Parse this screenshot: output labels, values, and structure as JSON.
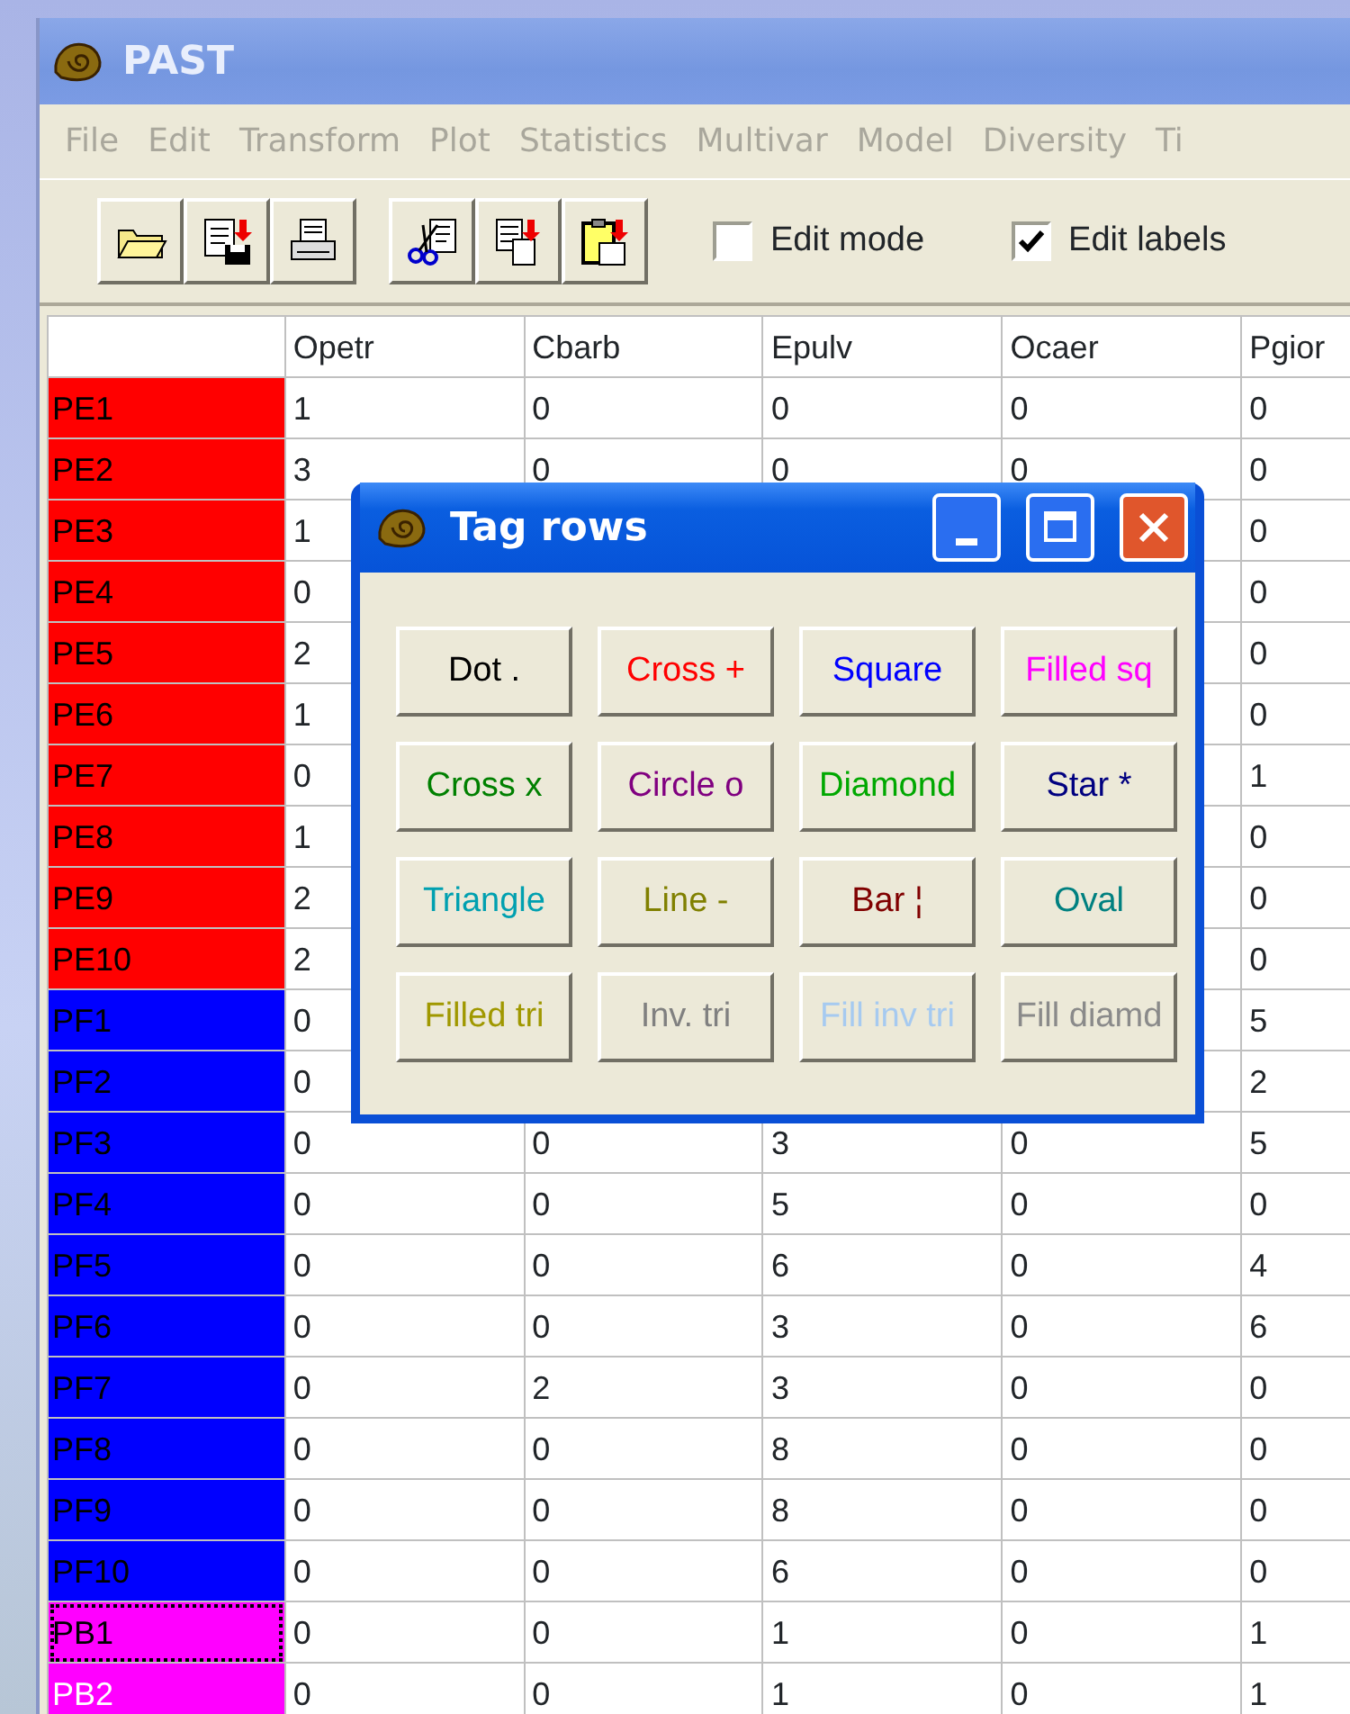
{
  "window": {
    "title": "PAST"
  },
  "menu": [
    "File",
    "Edit",
    "Transform",
    "Plot",
    "Statistics",
    "Multivar",
    "Model",
    "Diversity",
    "Ti"
  ],
  "toolbar": {
    "groups": [
      [
        {
          "kind": "open"
        },
        {
          "kind": "save"
        },
        {
          "kind": "print"
        }
      ],
      [
        {
          "kind": "cut"
        },
        {
          "kind": "copy"
        },
        {
          "kind": "paste"
        }
      ]
    ],
    "checkboxes": [
      {
        "label": "Edit mode",
        "checked": false
      },
      {
        "label": "Edit labels",
        "checked": true
      }
    ]
  },
  "table": {
    "columns": [
      "Opetr",
      "Cbarb",
      "Epulv",
      "Ocaer",
      "Pgior"
    ],
    "rows": [
      {
        "label": "PE1",
        "color": "#ff0000",
        "focused": false,
        "selected": false,
        "cells": [
          "1",
          "0",
          "0",
          "0",
          "0"
        ]
      },
      {
        "label": "PE2",
        "color": "#ff0000",
        "focused": false,
        "selected": false,
        "cells": [
          "3",
          "0",
          "0",
          "0",
          "0"
        ]
      },
      {
        "label": "PE3",
        "color": "#ff0000",
        "focused": false,
        "selected": false,
        "cells": [
          "1",
          null,
          null,
          null,
          "0"
        ]
      },
      {
        "label": "PE4",
        "color": "#ff0000",
        "focused": false,
        "selected": false,
        "cells": [
          "0",
          null,
          null,
          null,
          "0"
        ]
      },
      {
        "label": "PE5",
        "color": "#ff0000",
        "focused": false,
        "selected": false,
        "cells": [
          "2",
          null,
          null,
          null,
          "0"
        ]
      },
      {
        "label": "PE6",
        "color": "#ff0000",
        "focused": false,
        "selected": false,
        "cells": [
          "1",
          null,
          null,
          null,
          "0"
        ]
      },
      {
        "label": "PE7",
        "color": "#ff0000",
        "focused": false,
        "selected": false,
        "cells": [
          "0",
          null,
          null,
          null,
          "1"
        ]
      },
      {
        "label": "PE8",
        "color": "#ff0000",
        "focused": false,
        "selected": false,
        "cells": [
          "1",
          null,
          null,
          null,
          "0"
        ]
      },
      {
        "label": "PE9",
        "color": "#ff0000",
        "focused": false,
        "selected": false,
        "cells": [
          "2",
          null,
          null,
          null,
          "0"
        ]
      },
      {
        "label": "PE10",
        "color": "#ff0000",
        "focused": false,
        "selected": false,
        "cells": [
          "2",
          null,
          null,
          null,
          "0"
        ]
      },
      {
        "label": "PF1",
        "color": "#0000ff",
        "focused": false,
        "selected": false,
        "cells": [
          "0",
          null,
          null,
          null,
          "5"
        ]
      },
      {
        "label": "PF2",
        "color": "#0000ff",
        "focused": false,
        "selected": false,
        "cells": [
          "0",
          null,
          null,
          null,
          "2"
        ]
      },
      {
        "label": "PF3",
        "color": "#0000ff",
        "focused": false,
        "selected": false,
        "cells": [
          "0",
          "0",
          "3",
          "0",
          "5"
        ]
      },
      {
        "label": "PF4",
        "color": "#0000ff",
        "focused": false,
        "selected": false,
        "cells": [
          "0",
          "0",
          "5",
          "0",
          "0"
        ]
      },
      {
        "label": "PF5",
        "color": "#0000ff",
        "focused": false,
        "selected": false,
        "cells": [
          "0",
          "0",
          "6",
          "0",
          "4"
        ]
      },
      {
        "label": "PF6",
        "color": "#0000ff",
        "focused": false,
        "selected": false,
        "cells": [
          "0",
          "0",
          "3",
          "0",
          "6"
        ]
      },
      {
        "label": "PF7",
        "color": "#0000ff",
        "focused": false,
        "selected": false,
        "cells": [
          "0",
          "2",
          "3",
          "0",
          "0"
        ]
      },
      {
        "label": "PF8",
        "color": "#0000ff",
        "focused": false,
        "selected": false,
        "cells": [
          "0",
          "0",
          "8",
          "0",
          "0"
        ]
      },
      {
        "label": "PF9",
        "color": "#0000ff",
        "focused": false,
        "selected": false,
        "cells": [
          "0",
          "0",
          "8",
          "0",
          "0"
        ]
      },
      {
        "label": "PF10",
        "color": "#0000ff",
        "focused": false,
        "selected": false,
        "cells": [
          "0",
          "0",
          "6",
          "0",
          "0"
        ]
      },
      {
        "label": "PB1",
        "color": "#ff00ff",
        "focused": true,
        "selected": false,
        "cells": [
          "0",
          "0",
          "1",
          "0",
          "1"
        ]
      },
      {
        "label": "PB2",
        "color": "#ff00ff",
        "focused": false,
        "selected": true,
        "cells": [
          "0",
          "0",
          "1",
          "0",
          "1"
        ]
      }
    ]
  },
  "dialog": {
    "title": "Tag rows",
    "buttons": [
      {
        "label": "Dot .",
        "color": "#000000"
      },
      {
        "label": "Cross +",
        "color": "#ff0000"
      },
      {
        "label": "Square",
        "color": "#0000ff"
      },
      {
        "label": "Filled sq",
        "color": "#ff00ff"
      },
      {
        "label": "Cross x",
        "color": "#008000"
      },
      {
        "label": "Circle o",
        "color": "#800080"
      },
      {
        "label": "Diamond",
        "color": "#00a800"
      },
      {
        "label": "Star *",
        "color": "#000080"
      },
      {
        "label": "Triangle",
        "color": "#00a0b0"
      },
      {
        "label": "Line -",
        "color": "#808000"
      },
      {
        "label": "Bar ¦",
        "color": "#800000"
      },
      {
        "label": "Oval",
        "color": "#008080"
      },
      {
        "label": "Filled tri",
        "color": "#a09800"
      },
      {
        "label": "Inv. tri",
        "color": "#808080"
      },
      {
        "label": "Fill inv tri",
        "color": "#a6caf0"
      },
      {
        "label": "Fill diamd",
        "color": "#8a8a8a"
      }
    ]
  }
}
